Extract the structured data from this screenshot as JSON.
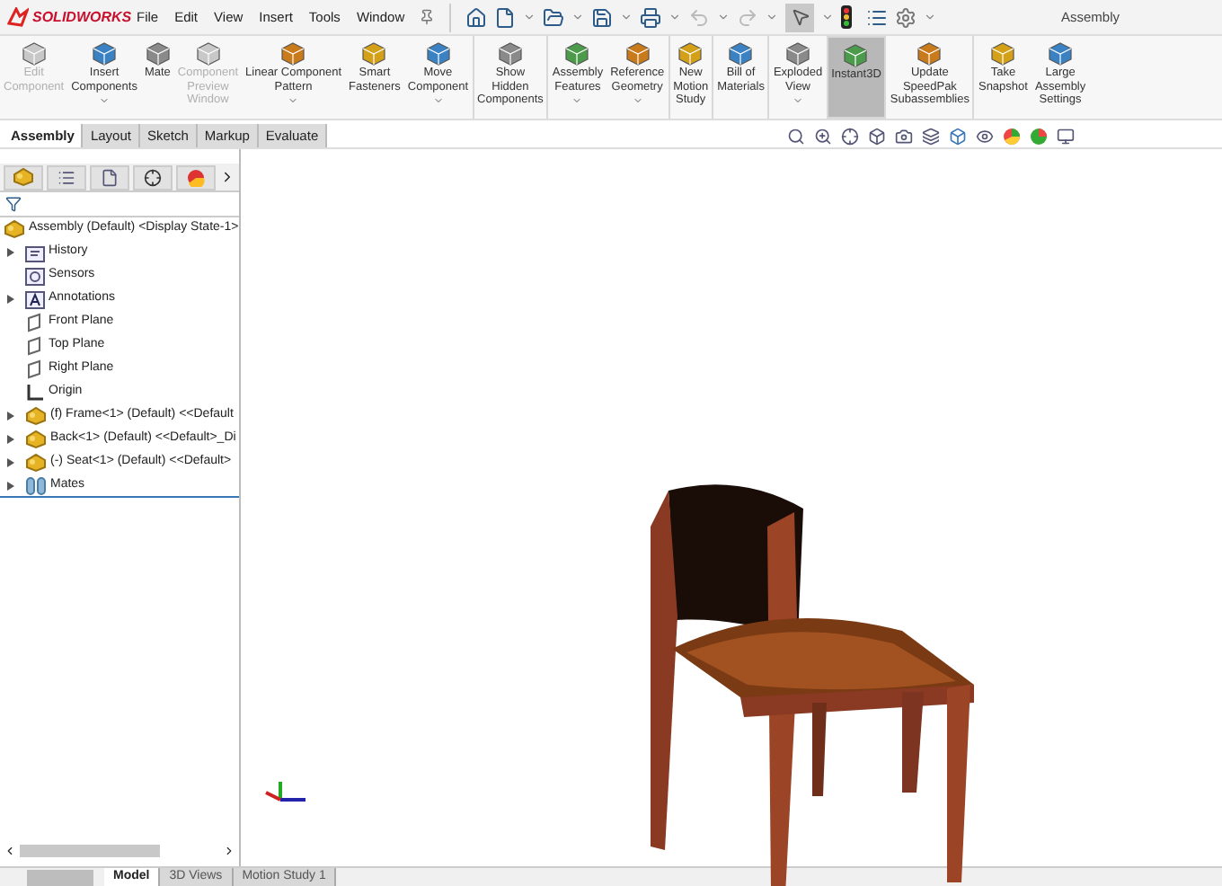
{
  "app": {
    "brand": "SOLIDWORKS",
    "title": "Assembly"
  },
  "menu": [
    "File",
    "Edit",
    "View",
    "Insert",
    "Tools",
    "Window"
  ],
  "ribbon": [
    {
      "lines": [
        "Edit",
        "Component"
      ],
      "disabled": true,
      "dropdown": false,
      "selected": false,
      "group_end": false
    },
    {
      "lines": [
        "Insert",
        "Components"
      ],
      "disabled": false,
      "dropdown": true,
      "selected": false,
      "group_end": false
    },
    {
      "lines": [
        "Mate"
      ],
      "disabled": false,
      "dropdown": false,
      "selected": false,
      "group_end": false
    },
    {
      "lines": [
        "Component",
        "Preview",
        "Window"
      ],
      "disabled": true,
      "dropdown": false,
      "selected": false,
      "group_end": false
    },
    {
      "lines": [
        "Linear Component",
        "Pattern"
      ],
      "disabled": false,
      "dropdown": true,
      "selected": false,
      "group_end": false
    },
    {
      "lines": [
        "Smart",
        "Fasteners"
      ],
      "disabled": false,
      "dropdown": false,
      "selected": false,
      "group_end": false
    },
    {
      "lines": [
        "Move",
        "Component"
      ],
      "disabled": false,
      "dropdown": true,
      "selected": false,
      "group_end": true
    },
    {
      "lines": [
        "Show",
        "Hidden",
        "Components"
      ],
      "disabled": false,
      "dropdown": false,
      "selected": false,
      "group_end": true
    },
    {
      "lines": [
        "Assembly",
        "Features"
      ],
      "disabled": false,
      "dropdown": true,
      "selected": false,
      "group_end": false
    },
    {
      "lines": [
        "Reference",
        "Geometry"
      ],
      "disabled": false,
      "dropdown": true,
      "selected": false,
      "group_end": true
    },
    {
      "lines": [
        "New",
        "Motion",
        "Study"
      ],
      "disabled": false,
      "dropdown": false,
      "selected": false,
      "group_end": true
    },
    {
      "lines": [
        "Bill of",
        "Materials"
      ],
      "disabled": false,
      "dropdown": false,
      "selected": false,
      "group_end": true
    },
    {
      "lines": [
        "Exploded",
        "View"
      ],
      "disabled": false,
      "dropdown": true,
      "selected": false,
      "group_end": false
    },
    {
      "lines": [
        "Instant3D"
      ],
      "disabled": false,
      "dropdown": false,
      "selected": true,
      "group_end": true
    },
    {
      "lines": [
        "Update",
        "SpeedPak",
        "Subassemblies"
      ],
      "disabled": false,
      "dropdown": false,
      "selected": false,
      "group_end": true
    },
    {
      "lines": [
        "Take",
        "Snapshot"
      ],
      "disabled": false,
      "dropdown": false,
      "selected": false,
      "group_end": false
    },
    {
      "lines": [
        "Large",
        "Assembly",
        "Settings"
      ],
      "disabled": false,
      "dropdown": false,
      "selected": false,
      "group_end": false
    }
  ],
  "command_tabs": [
    {
      "label": "Assembly",
      "selected": true
    },
    {
      "label": "Layout",
      "selected": false
    },
    {
      "label": "Sketch",
      "selected": false
    },
    {
      "label": "Markup",
      "selected": false
    },
    {
      "label": "Evaluate",
      "selected": false
    }
  ],
  "tree": {
    "root": "Assembly (Default) <Display State-1>",
    "children": [
      {
        "label": "History",
        "kind": "folder",
        "expandable": true
      },
      {
        "label": "Sensors",
        "kind": "sensor",
        "expandable": false
      },
      {
        "label": "Annotations",
        "kind": "annotation",
        "expandable": true
      },
      {
        "label": "Front Plane",
        "kind": "plane",
        "expandable": false
      },
      {
        "label": "Top Plane",
        "kind": "plane",
        "expandable": false
      },
      {
        "label": "Right Plane",
        "kind": "plane",
        "expandable": false
      },
      {
        "label": "Origin",
        "kind": "origin",
        "expandable": false
      },
      {
        "label": "(f) Frame<1> (Default) <<Default",
        "kind": "part",
        "expandable": true
      },
      {
        "label": "Back<1> (Default) <<Default>_Di",
        "kind": "part",
        "expandable": true
      },
      {
        "label": "(-) Seat<1> (Default) <<Default>",
        "kind": "part",
        "expandable": true
      },
      {
        "label": "Mates",
        "kind": "mates",
        "expandable": true
      }
    ]
  },
  "bottom_tabs": [
    {
      "label": "Model",
      "selected": true
    },
    {
      "label": "3D Views",
      "selected": false
    },
    {
      "label": "Motion Study 1",
      "selected": false
    }
  ]
}
